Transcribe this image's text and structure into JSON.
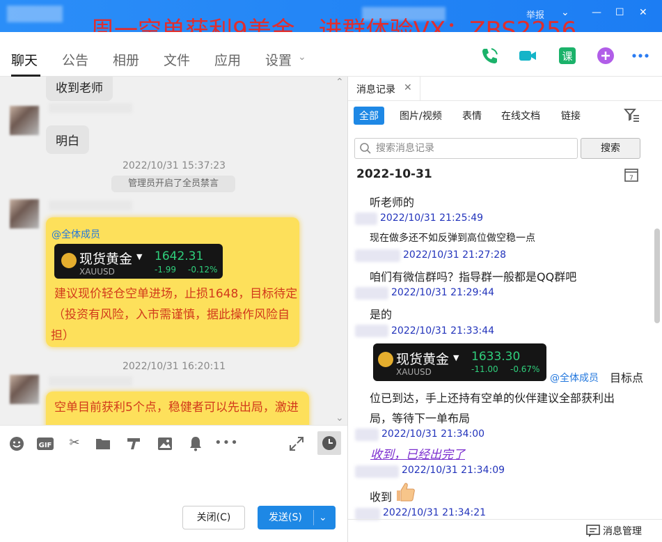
{
  "overlay_title": "周一空单获利9美金，进群体验VX：ZBS2256",
  "window": {
    "report": "举报"
  },
  "tabs": [
    {
      "label": "聊天"
    },
    {
      "label": "公告"
    },
    {
      "label": "相册"
    },
    {
      "label": "文件"
    },
    {
      "label": "应用"
    },
    {
      "label": "设置"
    }
  ],
  "chat": {
    "msg1": "收到老师",
    "msg2": "明白",
    "ts1": "2022/10/31 15:37:23",
    "system1": "管理员开启了全员禁言",
    "card1": {
      "mention": "@全体成员",
      "gold_name": "现货黄金",
      "gold_sub": "XAUUSD",
      "gold_price": "1642.31",
      "gold_change": "-1.99",
      "gold_change_pct": "-0.12%",
      "line1": "建议现价轻仓空单进场，止损1648，目标待定",
      "line2": "（投资有风险，入市需谨慎，据此操作风险自",
      "line3": "担）"
    },
    "ts2": "2022/10/31 16:20:11",
    "msg3_line1": "空单目前获利5个点，稳健者可以先出局，激进"
  },
  "buttons": {
    "close": "关闭(C)",
    "send": "发送(S)"
  },
  "right_panel": {
    "tab": "消息记录",
    "filters": [
      "全部",
      "图片/视频",
      "表情",
      "在线文档",
      "链接"
    ],
    "search_placeholder": "搜索消息记录",
    "search_button": "搜索",
    "date": "2022-10-31",
    "messages": [
      {
        "text": "听老师的",
        "time": "2022/10/31 21:25:49"
      },
      {
        "text": "现在做多还不如反弹到高位做空稳一点",
        "time": "2022/10/31 21:27:28"
      },
      {
        "text": "咱们有微信群吗？指导群一般都是QQ群吧",
        "time": "2022/10/31 21:29:44"
      },
      {
        "text": "是的",
        "time": "2022/10/31 21:33:44"
      }
    ],
    "card2": {
      "gold_name": "现货黄金",
      "gold_sub": "XAUUSD",
      "gold_price": "1633.30",
      "gold_change": "-11.00",
      "gold_change_pct": "-0.67%",
      "mention": "@全体成员",
      "after": "目标点",
      "line2": "位已到达，手上还持有空单的伙伴建议全部获利出",
      "line3": "局，等待下一单布局",
      "time": "2022/10/31 21:34:00"
    },
    "link_msg": "收到，已经出完了",
    "link_time": "2022/10/31 21:34:09",
    "last_msg": "收到",
    "last_time": "2022/10/31 21:34:21",
    "footer": "消息管理"
  }
}
